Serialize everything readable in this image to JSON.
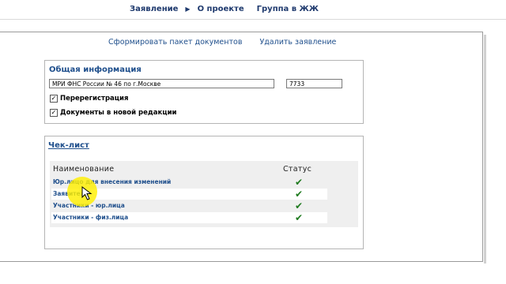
{
  "nav": {
    "items": [
      "Заявление",
      "О проекте",
      "Группа в ЖЖ"
    ],
    "separator_icon": "triangle-right-icon"
  },
  "actions": {
    "build_package": "Сформировать пакет документов",
    "delete_application": "Удалить заявление"
  },
  "general": {
    "title": "Общая информация",
    "tax_office_value": "МРИ ФНС России № 46 по г.Москве",
    "code_value": "7733",
    "reregistration": {
      "label": "Перерегистрация",
      "checked": true
    },
    "new_docs": {
      "label": "Документы в новой редакции",
      "checked": true
    },
    "check_mark": "✓"
  },
  "checklist": {
    "title": "Чек-лист",
    "columns": {
      "name": "Наименование",
      "status": "Статус"
    },
    "rows": [
      {
        "name": "Юр.лицо для внесения изменений",
        "status": "✔"
      },
      {
        "name": "Заявитель",
        "status": "✔"
      },
      {
        "name": "Участники - юр.лица",
        "status": "✔"
      },
      {
        "name": "Участники - физ.лица",
        "status": "✔"
      }
    ]
  },
  "colors": {
    "link": "#1f4f8c",
    "nav": "#1f3a6e",
    "status_ok": "#1e7a1e",
    "cursor_highlight": "#ffef00"
  }
}
